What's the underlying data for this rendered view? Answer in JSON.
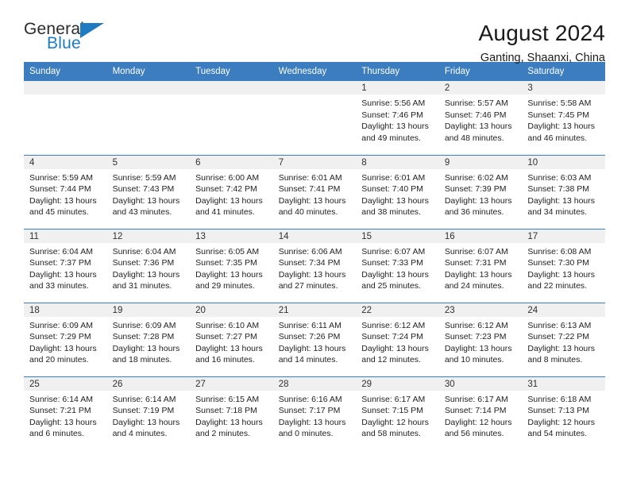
{
  "brand": {
    "name_part1": "General",
    "name_part2": "Blue",
    "accent_color": "#1f7bc1"
  },
  "header": {
    "title": "August 2024",
    "subtitle": "Ganting, Shaanxi, China"
  },
  "calendar": {
    "header_bg": "#3b7dbf",
    "daynum_bg": "#f0f0f0",
    "weekday_headers": [
      "Sunday",
      "Monday",
      "Tuesday",
      "Wednesday",
      "Thursday",
      "Friday",
      "Saturday"
    ],
    "weeks": [
      [
        {
          "day": "",
          "empty": true
        },
        {
          "day": "",
          "empty": true
        },
        {
          "day": "",
          "empty": true
        },
        {
          "day": "",
          "empty": true
        },
        {
          "day": "1",
          "sunrise": "Sunrise: 5:56 AM",
          "sunset": "Sunset: 7:46 PM",
          "daylight1": "Daylight: 13 hours",
          "daylight2": "and 49 minutes."
        },
        {
          "day": "2",
          "sunrise": "Sunrise: 5:57 AM",
          "sunset": "Sunset: 7:46 PM",
          "daylight1": "Daylight: 13 hours",
          "daylight2": "and 48 minutes."
        },
        {
          "day": "3",
          "sunrise": "Sunrise: 5:58 AM",
          "sunset": "Sunset: 7:45 PM",
          "daylight1": "Daylight: 13 hours",
          "daylight2": "and 46 minutes."
        }
      ],
      [
        {
          "day": "4",
          "sunrise": "Sunrise: 5:59 AM",
          "sunset": "Sunset: 7:44 PM",
          "daylight1": "Daylight: 13 hours",
          "daylight2": "and 45 minutes."
        },
        {
          "day": "5",
          "sunrise": "Sunrise: 5:59 AM",
          "sunset": "Sunset: 7:43 PM",
          "daylight1": "Daylight: 13 hours",
          "daylight2": "and 43 minutes."
        },
        {
          "day": "6",
          "sunrise": "Sunrise: 6:00 AM",
          "sunset": "Sunset: 7:42 PM",
          "daylight1": "Daylight: 13 hours",
          "daylight2": "and 41 minutes."
        },
        {
          "day": "7",
          "sunrise": "Sunrise: 6:01 AM",
          "sunset": "Sunset: 7:41 PM",
          "daylight1": "Daylight: 13 hours",
          "daylight2": "and 40 minutes."
        },
        {
          "day": "8",
          "sunrise": "Sunrise: 6:01 AM",
          "sunset": "Sunset: 7:40 PM",
          "daylight1": "Daylight: 13 hours",
          "daylight2": "and 38 minutes."
        },
        {
          "day": "9",
          "sunrise": "Sunrise: 6:02 AM",
          "sunset": "Sunset: 7:39 PM",
          "daylight1": "Daylight: 13 hours",
          "daylight2": "and 36 minutes."
        },
        {
          "day": "10",
          "sunrise": "Sunrise: 6:03 AM",
          "sunset": "Sunset: 7:38 PM",
          "daylight1": "Daylight: 13 hours",
          "daylight2": "and 34 minutes."
        }
      ],
      [
        {
          "day": "11",
          "sunrise": "Sunrise: 6:04 AM",
          "sunset": "Sunset: 7:37 PM",
          "daylight1": "Daylight: 13 hours",
          "daylight2": "and 33 minutes."
        },
        {
          "day": "12",
          "sunrise": "Sunrise: 6:04 AM",
          "sunset": "Sunset: 7:36 PM",
          "daylight1": "Daylight: 13 hours",
          "daylight2": "and 31 minutes."
        },
        {
          "day": "13",
          "sunrise": "Sunrise: 6:05 AM",
          "sunset": "Sunset: 7:35 PM",
          "daylight1": "Daylight: 13 hours",
          "daylight2": "and 29 minutes."
        },
        {
          "day": "14",
          "sunrise": "Sunrise: 6:06 AM",
          "sunset": "Sunset: 7:34 PM",
          "daylight1": "Daylight: 13 hours",
          "daylight2": "and 27 minutes."
        },
        {
          "day": "15",
          "sunrise": "Sunrise: 6:07 AM",
          "sunset": "Sunset: 7:33 PM",
          "daylight1": "Daylight: 13 hours",
          "daylight2": "and 25 minutes."
        },
        {
          "day": "16",
          "sunrise": "Sunrise: 6:07 AM",
          "sunset": "Sunset: 7:31 PM",
          "daylight1": "Daylight: 13 hours",
          "daylight2": "and 24 minutes."
        },
        {
          "day": "17",
          "sunrise": "Sunrise: 6:08 AM",
          "sunset": "Sunset: 7:30 PM",
          "daylight1": "Daylight: 13 hours",
          "daylight2": "and 22 minutes."
        }
      ],
      [
        {
          "day": "18",
          "sunrise": "Sunrise: 6:09 AM",
          "sunset": "Sunset: 7:29 PM",
          "daylight1": "Daylight: 13 hours",
          "daylight2": "and 20 minutes."
        },
        {
          "day": "19",
          "sunrise": "Sunrise: 6:09 AM",
          "sunset": "Sunset: 7:28 PM",
          "daylight1": "Daylight: 13 hours",
          "daylight2": "and 18 minutes."
        },
        {
          "day": "20",
          "sunrise": "Sunrise: 6:10 AM",
          "sunset": "Sunset: 7:27 PM",
          "daylight1": "Daylight: 13 hours",
          "daylight2": "and 16 minutes."
        },
        {
          "day": "21",
          "sunrise": "Sunrise: 6:11 AM",
          "sunset": "Sunset: 7:26 PM",
          "daylight1": "Daylight: 13 hours",
          "daylight2": "and 14 minutes."
        },
        {
          "day": "22",
          "sunrise": "Sunrise: 6:12 AM",
          "sunset": "Sunset: 7:24 PM",
          "daylight1": "Daylight: 13 hours",
          "daylight2": "and 12 minutes."
        },
        {
          "day": "23",
          "sunrise": "Sunrise: 6:12 AM",
          "sunset": "Sunset: 7:23 PM",
          "daylight1": "Daylight: 13 hours",
          "daylight2": "and 10 minutes."
        },
        {
          "day": "24",
          "sunrise": "Sunrise: 6:13 AM",
          "sunset": "Sunset: 7:22 PM",
          "daylight1": "Daylight: 13 hours",
          "daylight2": "and 8 minutes."
        }
      ],
      [
        {
          "day": "25",
          "sunrise": "Sunrise: 6:14 AM",
          "sunset": "Sunset: 7:21 PM",
          "daylight1": "Daylight: 13 hours",
          "daylight2": "and 6 minutes."
        },
        {
          "day": "26",
          "sunrise": "Sunrise: 6:14 AM",
          "sunset": "Sunset: 7:19 PM",
          "daylight1": "Daylight: 13 hours",
          "daylight2": "and 4 minutes."
        },
        {
          "day": "27",
          "sunrise": "Sunrise: 6:15 AM",
          "sunset": "Sunset: 7:18 PM",
          "daylight1": "Daylight: 13 hours",
          "daylight2": "and 2 minutes."
        },
        {
          "day": "28",
          "sunrise": "Sunrise: 6:16 AM",
          "sunset": "Sunset: 7:17 PM",
          "daylight1": "Daylight: 13 hours",
          "daylight2": "and 0 minutes."
        },
        {
          "day": "29",
          "sunrise": "Sunrise: 6:17 AM",
          "sunset": "Sunset: 7:15 PM",
          "daylight1": "Daylight: 12 hours",
          "daylight2": "and 58 minutes."
        },
        {
          "day": "30",
          "sunrise": "Sunrise: 6:17 AM",
          "sunset": "Sunset: 7:14 PM",
          "daylight1": "Daylight: 12 hours",
          "daylight2": "and 56 minutes."
        },
        {
          "day": "31",
          "sunrise": "Sunrise: 6:18 AM",
          "sunset": "Sunset: 7:13 PM",
          "daylight1": "Daylight: 12 hours",
          "daylight2": "and 54 minutes."
        }
      ]
    ]
  }
}
